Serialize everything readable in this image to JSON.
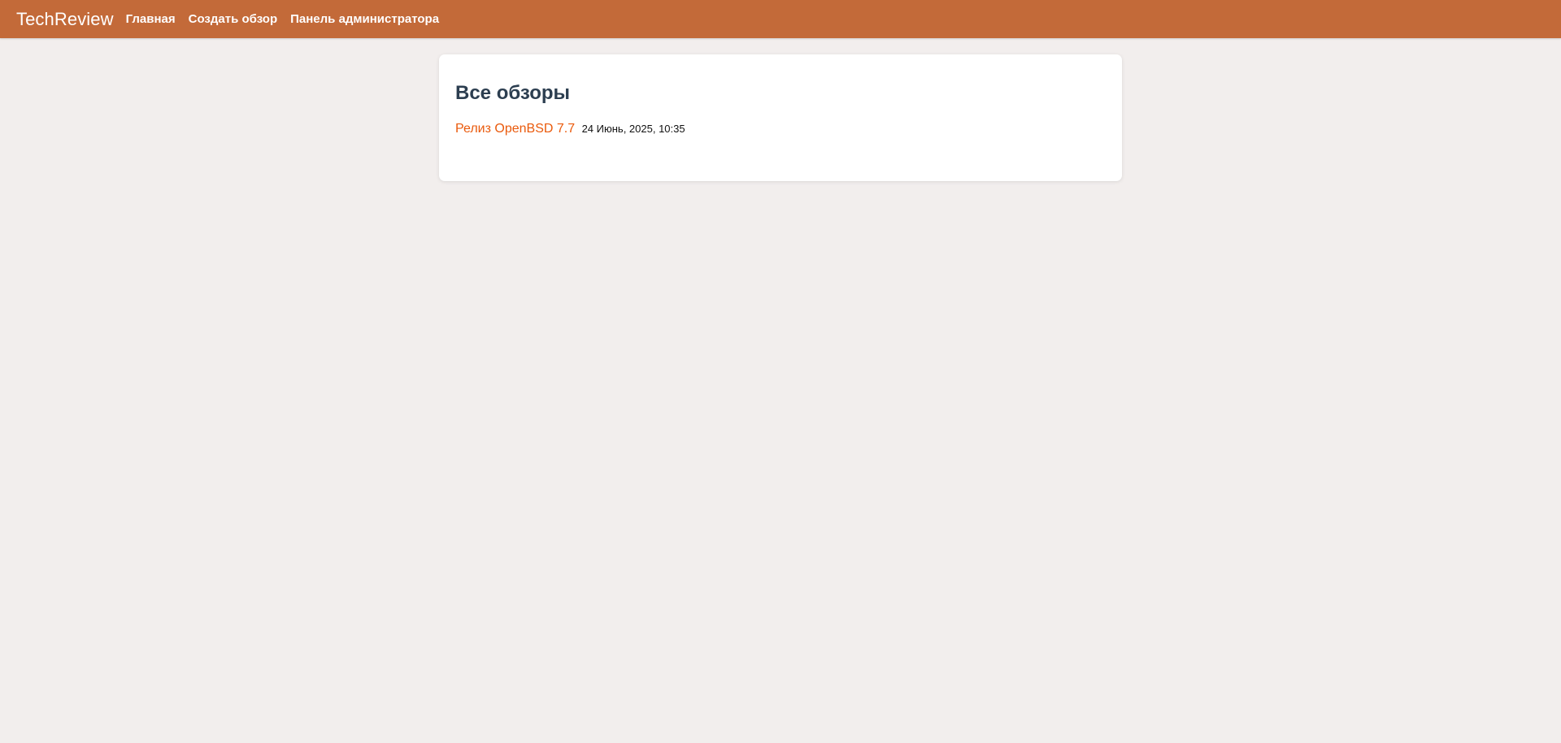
{
  "navbar": {
    "brand": "TechReview",
    "links": [
      {
        "label": "Главная"
      },
      {
        "label": "Создать обзор"
      },
      {
        "label": "Панель администратора"
      }
    ]
  },
  "main": {
    "title": "Все обзоры",
    "reviews": [
      {
        "title": "Релиз OpenBSD 7.7",
        "date": "24 Июнь, 2025, 10:35"
      }
    ]
  },
  "colors": {
    "navbar_bg": "#c36a39",
    "page_bg": "#f2eeed",
    "title": "#2c3e50",
    "link": "#ea5a0c"
  }
}
